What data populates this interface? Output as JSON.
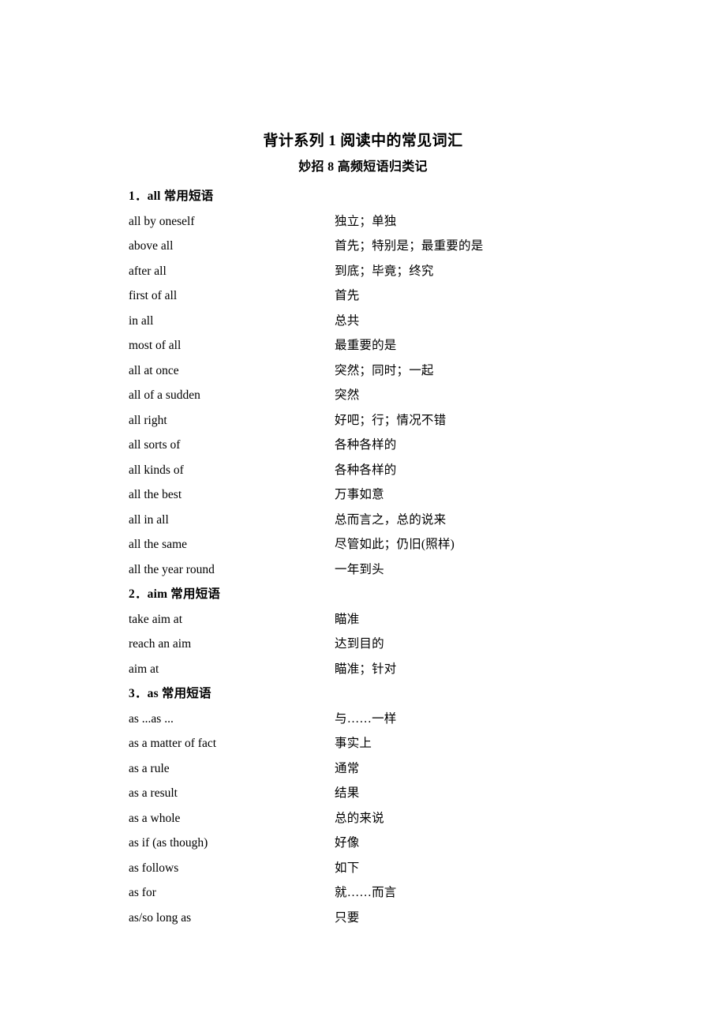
{
  "document": {
    "title": "背计系列 1  阅读中的常见词汇",
    "subtitle": "妙招 8  高频短语归类记"
  },
  "sections": [
    {
      "heading_number": "1．",
      "heading_keyword": "all",
      "heading_suffix": " 常用短语",
      "heading_full": "1．all 常用短语",
      "entries": [
        {
          "term": "all by oneself",
          "gloss": "独立；单独"
        },
        {
          "term": "above all",
          "gloss": "首先；特别是；最重要的是"
        },
        {
          "term": "after all",
          "gloss": "到底；毕竟；终究"
        },
        {
          "term": "first of all",
          "gloss": "首先"
        },
        {
          "term": "in all",
          "gloss": "总共"
        },
        {
          "term": "most of all",
          "gloss": "最重要的是"
        },
        {
          "term": "all at once",
          "gloss": "突然；同时；一起"
        },
        {
          "term": "all of a sudden",
          "gloss": "突然"
        },
        {
          "term": "all right",
          "gloss": "好吧；行；情况不错"
        },
        {
          "term": "all sorts of",
          "gloss": "各种各样的"
        },
        {
          "term": "all kinds of",
          "gloss": "各种各样的"
        },
        {
          "term": "all the best",
          "gloss": "万事如意"
        },
        {
          "term": "all in all",
          "gloss": "总而言之，总的说来"
        },
        {
          "term": "all the same",
          "gloss": "尽管如此；仍旧(照样)"
        },
        {
          "term": "all the year round",
          "gloss": "一年到头"
        }
      ]
    },
    {
      "heading_number": "2．",
      "heading_keyword": "aim",
      "heading_suffix": " 常用短语",
      "heading_full": "2．aim 常用短语",
      "entries": [
        {
          "term": "take aim at",
          "gloss": "瞄准"
        },
        {
          "term": "reach an aim",
          "gloss": "达到目的"
        },
        {
          "term": "aim at",
          "gloss": "瞄准；针对"
        }
      ]
    },
    {
      "heading_number": "3．",
      "heading_keyword": "as",
      "heading_suffix": " 常用短语",
      "heading_full": "3．as 常用短语",
      "entries": [
        {
          "term": "as ...as ...",
          "gloss": "与……一样"
        },
        {
          "term": "as a matter of fact",
          "gloss": "事实上"
        },
        {
          "term": "as a rule",
          "gloss": "通常"
        },
        {
          "term": "as a result",
          "gloss": "结果"
        },
        {
          "term": "as a whole",
          "gloss": "总的来说"
        },
        {
          "term": "as if (as though)",
          "gloss": "好像"
        },
        {
          "term": "as follows",
          "gloss": "如下"
        },
        {
          "term": "as for",
          "gloss": "就……而言"
        },
        {
          "term": "as/so long as",
          "gloss": "只要"
        }
      ]
    }
  ]
}
